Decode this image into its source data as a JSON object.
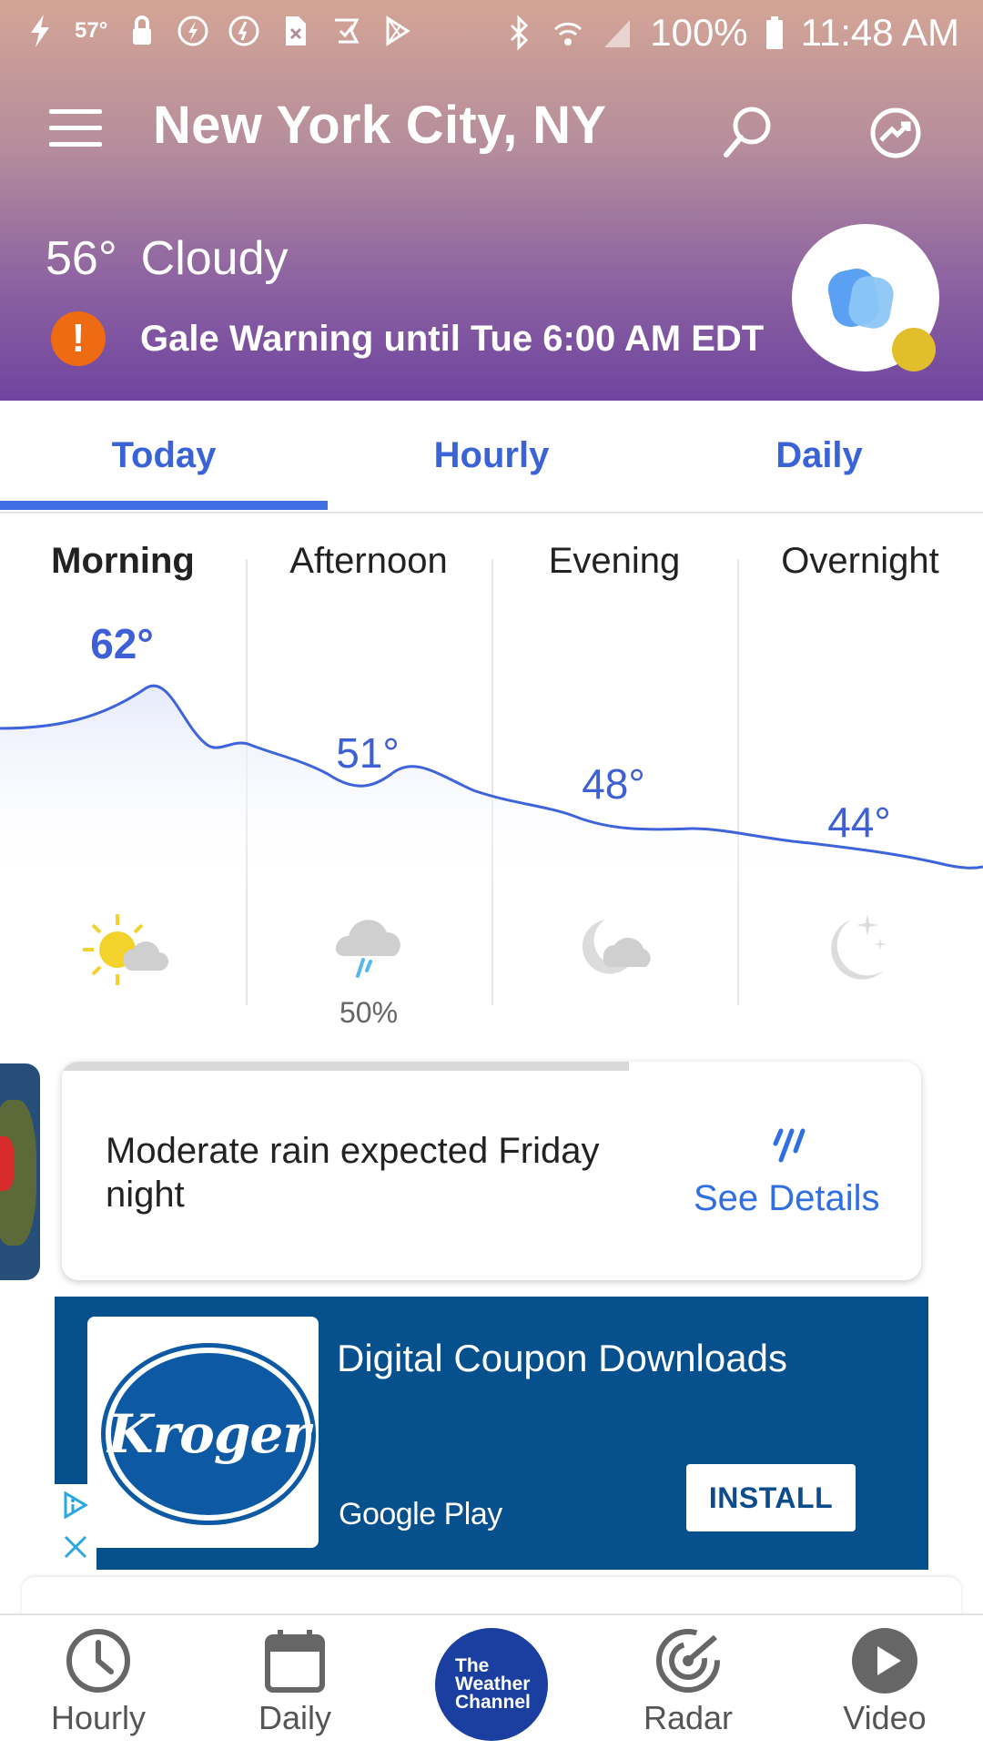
{
  "status_bar": {
    "temperature": "57°",
    "battery": "100%",
    "time": "11:48 AM"
  },
  "header": {
    "city": "New York City, NY",
    "current_temp": "56°",
    "condition": "Cloudy",
    "alert_text": "Gale Warning until Tue 6:00 AM EDT",
    "alert_badge": "!"
  },
  "tabs": [
    {
      "label": "Today",
      "selected": true
    },
    {
      "label": "Hourly",
      "selected": false
    },
    {
      "label": "Daily",
      "selected": false
    }
  ],
  "periods": [
    {
      "name": "Morning",
      "temp": "62°",
      "icon": "sun-cloud-icon",
      "precip": ""
    },
    {
      "name": "Afternoon",
      "temp": "51°",
      "icon": "rain-cloud-icon",
      "precip": "50%"
    },
    {
      "name": "Evening",
      "temp": "48°",
      "icon": "moon-cloud-icon",
      "precip": ""
    },
    {
      "name": "Overnight",
      "temp": "44°",
      "icon": "moon-stars-icon",
      "precip": ""
    }
  ],
  "rain_card": {
    "message": "Moderate rain expected Friday night",
    "link": "See Details",
    "progress": 0.66
  },
  "ad": {
    "brand": "Kroger",
    "title": "Digital Coupon Downloads",
    "store": "Google Play",
    "button": "INSTALL"
  },
  "bottom_nav": {
    "items": [
      {
        "label": "Hourly",
        "icon": "clock-icon"
      },
      {
        "label": "Daily",
        "icon": "calendar-icon"
      },
      {
        "label": "The\nWeather\nChannel",
        "icon": "twc-logo"
      },
      {
        "label": "Radar",
        "icon": "radar-icon"
      },
      {
        "label": "Video",
        "icon": "play-icon"
      }
    ]
  },
  "colors": {
    "accent": "#3e5fd5",
    "alert": "#ee6a13",
    "ad_bg": "#07508e"
  }
}
